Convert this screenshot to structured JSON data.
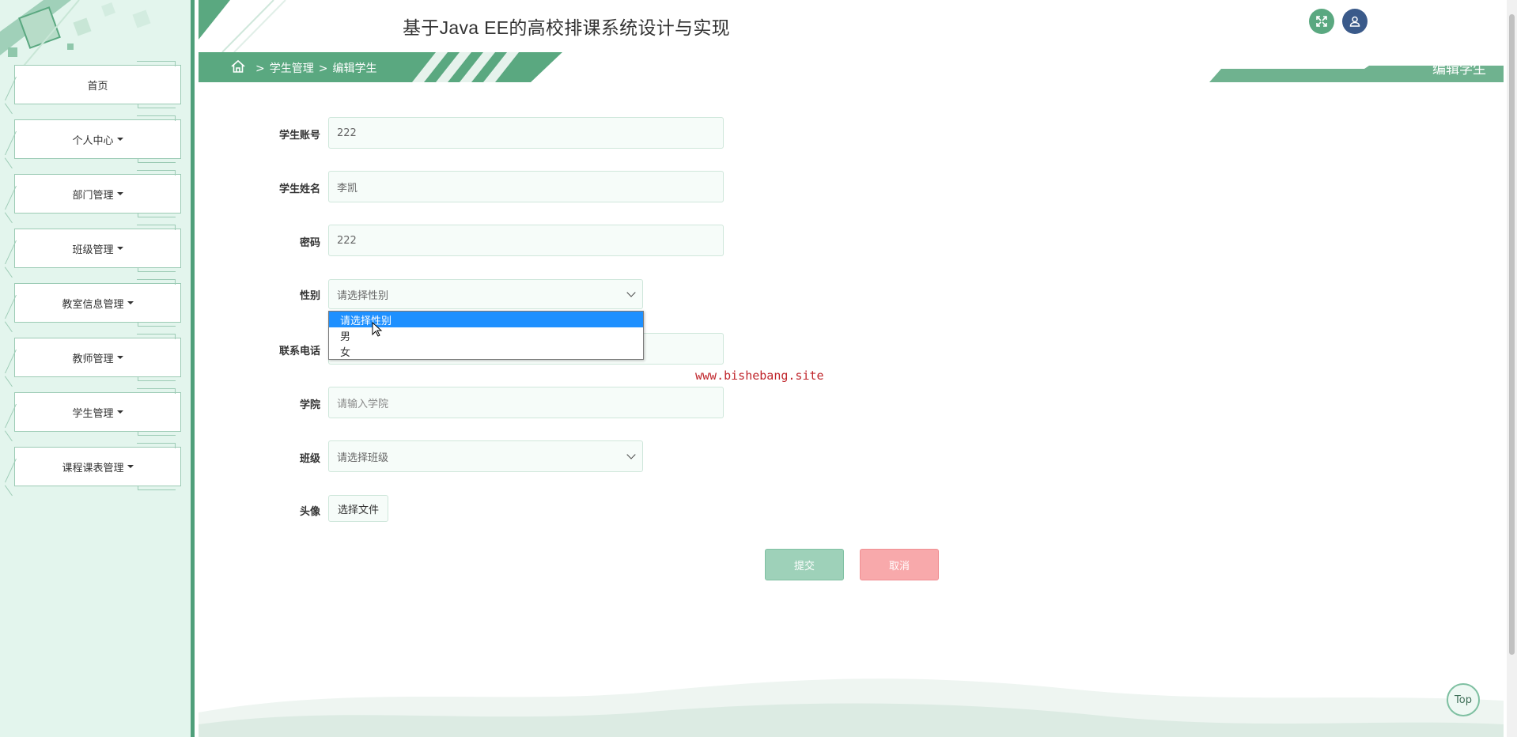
{
  "app": {
    "title": "基于Java EE的高校排课系统设计与实现"
  },
  "sidebar": {
    "items": [
      {
        "label": "首页",
        "has_caret": false
      },
      {
        "label": "个人中心",
        "has_caret": true
      },
      {
        "label": "部门管理",
        "has_caret": true
      },
      {
        "label": "班级管理",
        "has_caret": true
      },
      {
        "label": "教室信息管理",
        "has_caret": true
      },
      {
        "label": "教师管理",
        "has_caret": true
      },
      {
        "label": "学生管理",
        "has_caret": true
      },
      {
        "label": "课程课表管理",
        "has_caret": true
      }
    ]
  },
  "breadcrumb": {
    "sep": ">",
    "level1": "学生管理",
    "level2": "编辑学生"
  },
  "page_tab": {
    "label": "编辑学生"
  },
  "form": {
    "account": {
      "label": "学生账号",
      "value": "222"
    },
    "name": {
      "label": "学生姓名",
      "value": "李凯"
    },
    "password": {
      "label": "密码",
      "value": "222"
    },
    "gender": {
      "label": "性别",
      "value": "请选择性别",
      "options": [
        "请选择性别",
        "男",
        "女"
      ],
      "highlighted": "请选择性别"
    },
    "phone": {
      "label": "联系电话",
      "value": ""
    },
    "college": {
      "label": "学院",
      "placeholder": "请输入学院"
    },
    "class": {
      "label": "班级",
      "value": "请选择班级"
    },
    "avatar": {
      "label": "头像",
      "button": "选择文件"
    }
  },
  "actions": {
    "submit": "提交",
    "cancel": "取消"
  },
  "watermark": "www.bishebang.site",
  "top_button": "Top",
  "colors": {
    "accent": "#5aa880",
    "sidebar_bg": "#e3f5ed",
    "submit": "#9ed1b9",
    "cancel": "#f8a9ab",
    "selected_option": "#1e90ff"
  },
  "icons": {
    "fullscreen": "expand-icon",
    "user": "user-icon",
    "home": "home-icon"
  }
}
